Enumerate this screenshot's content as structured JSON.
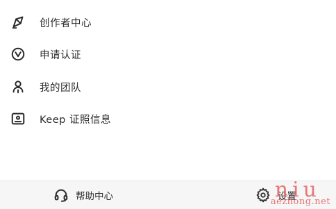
{
  "menu": {
    "items": [
      {
        "label": "创作者中心",
        "icon": "creator-center-icon"
      },
      {
        "label": "申请认证",
        "icon": "verify-icon"
      },
      {
        "label": "我的团队",
        "icon": "team-icon"
      },
      {
        "label": "Keep 证照信息",
        "icon": "license-icon"
      }
    ]
  },
  "footer": {
    "help_label": "帮助中心",
    "help_icon": "headset-icon",
    "settings_label": "设置",
    "settings_icon": "gear-icon"
  },
  "watermark": {
    "big": "niu",
    "small": "aezhong.net"
  },
  "colors": {
    "text": "#2b2b2b",
    "footer_bg": "#f6f6f6",
    "watermark": "#e35b5b"
  }
}
